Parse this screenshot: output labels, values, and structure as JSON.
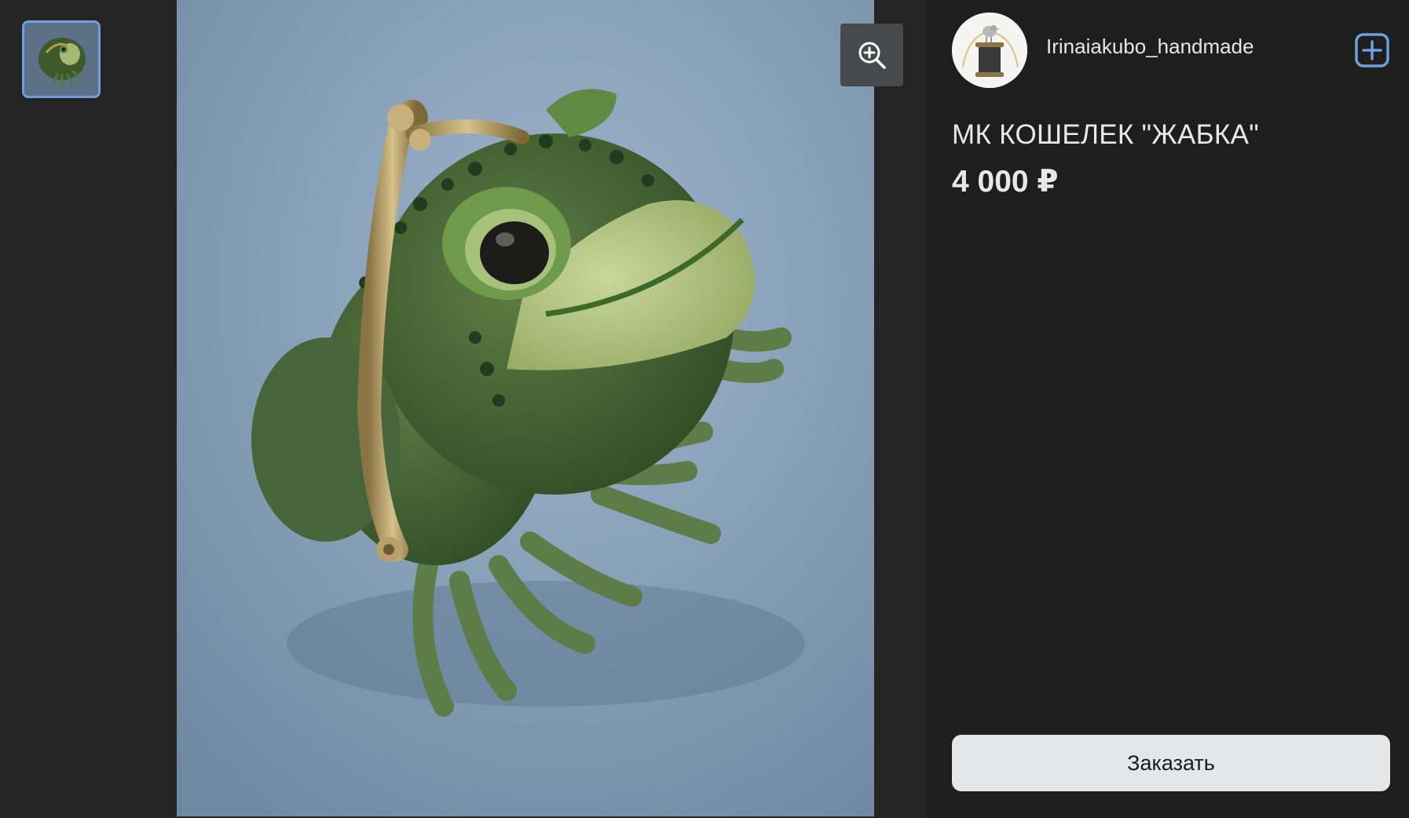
{
  "seller": {
    "name": "Irinaiakubo_handmade"
  },
  "product": {
    "title": "МК КОШЕЛЕК \"ЖАБКА\"",
    "price": "4 000 ₽"
  },
  "actions": {
    "order_label": "Заказать",
    "zoom_icon": "zoom-in-icon",
    "add_icon": "plus-square-icon"
  },
  "colors": {
    "thumb_border": "#6f9ed8",
    "add_icon": "#6f9ed8",
    "button_bg": "#e5e6e8"
  }
}
